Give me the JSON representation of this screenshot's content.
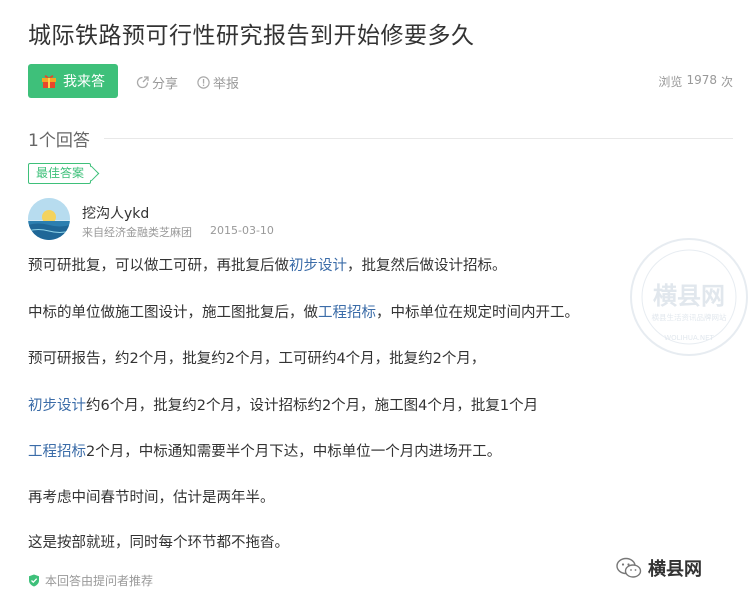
{
  "question": {
    "title": "城际铁路预可行性研究报告到开始修要多久"
  },
  "toolbar": {
    "answer_label": "我来答",
    "share_label": "分享",
    "report_label": "举报",
    "views_label": "浏览",
    "views_count": "1978",
    "views_unit": "次"
  },
  "answers": {
    "count_label": "1个回答",
    "best_badge": "最佳答案"
  },
  "author": {
    "name": "挖沟人ykd",
    "source": "来自经济金融类芝麻团",
    "date": "2015-03-10"
  },
  "content": {
    "p1": {
      "a": "预可研批复，可以做工可研，再批复后做",
      "link": "初步设计",
      "b": "，批复然后做设计招标。"
    },
    "p2": {
      "a": "中标的单位做施工图设计，施工图批复后，做",
      "link": "工程招标",
      "b": "，中标单位在规定时间内开工。"
    },
    "p3": "预可研报告，约2个月，批复约2个月，工可研约4个月，批复约2个月，",
    "p4": {
      "link": "初步设计",
      "b": "约6个月，批复约2个月，设计招标约2个月，施工图4个月，批复1个月"
    },
    "p5": {
      "link": "工程招标",
      "b": "2个月，中标通知需要半个月下达，中标单位一个月内进场开工。"
    },
    "p6": "再考虑中间春节时间，估计是两年半。",
    "p7": "这是按部就班，同时每个环节都不拖沓。"
  },
  "footer": {
    "recommend_note": "本回答由提问者推荐"
  },
  "watermark": {
    "main": "横县网",
    "sub": "横县生活资讯品牌网站",
    "url": "WOLIHUA.NET",
    "bottom": "横县网"
  },
  "colors": {
    "accent_green": "#3ec07a",
    "link_blue": "#3b6ca8",
    "muted": "#999999"
  },
  "icons": [
    "gift-icon",
    "share-icon",
    "report-icon",
    "shield-check-icon",
    "wechat-icon"
  ]
}
